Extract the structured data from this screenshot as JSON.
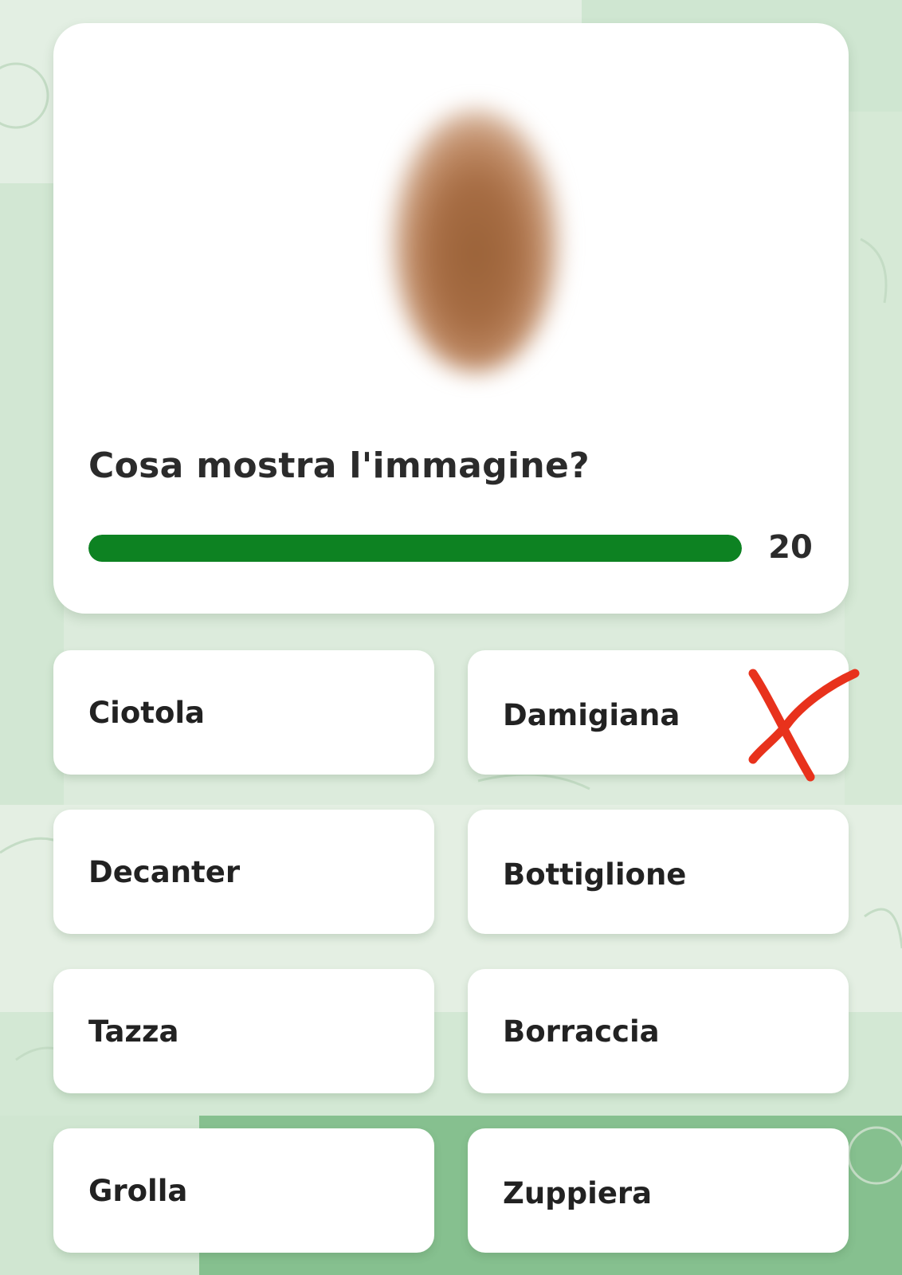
{
  "question": {
    "image_icon": "blurred-object-image",
    "text": "Cosa mostra l'immagine?",
    "timer_value": "20",
    "timer_fraction": 1.0
  },
  "answers": [
    {
      "label": "Ciotola"
    },
    {
      "label": "Damigiana"
    },
    {
      "label": "Decanter"
    },
    {
      "label": "Bottiglione"
    },
    {
      "label": "Tazza"
    },
    {
      "label": "Borraccia"
    },
    {
      "label": "Grolla"
    },
    {
      "label": "Zuppiera"
    }
  ],
  "wrong_mark_icon": "red-x-icon",
  "colors": {
    "timer_bar": "#0d8222",
    "wrong_mark": "#e8321c",
    "background": "#dcebdc",
    "background_dark": "#86c08f"
  }
}
